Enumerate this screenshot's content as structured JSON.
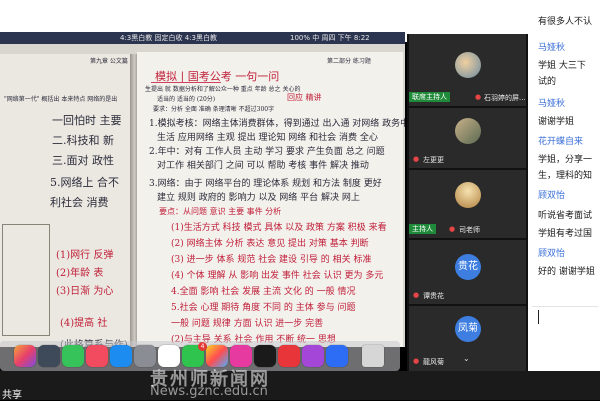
{
  "menubar": {
    "left": "4:3黑白教 固定白收 4:3黑白教",
    "right": "100% 中 周四 下午 8:22"
  },
  "document": {
    "left_page": {
      "header": "第九章 公文篇",
      "quote": "\"网络第一代\" 概括出 本来特点 网络的是出"
    },
    "right_page": {
      "header": "第二部分 练习题",
      "title_red": "模拟 | 国考公考 一句一问",
      "subtitle": "回应 精讲"
    }
  },
  "dock": {
    "apps": [
      "finder",
      "launchpad",
      "messages",
      "music",
      "app-store",
      "settings",
      "calendar",
      "wechat",
      "photos",
      "video",
      "netease-music",
      "podcasts",
      "lark",
      "trash"
    ],
    "badge_wechat": "4"
  },
  "participants": [
    {
      "name": "石羽婷的屏...",
      "badge": "联席主持人",
      "type": "photo"
    },
    {
      "name": "左更更",
      "badge": "",
      "type": "photo"
    },
    {
      "name": "司老师",
      "badge": "主持人",
      "type": "photo"
    },
    {
      "name": "谭贵花",
      "badge": "",
      "type": "text",
      "avatar": "贵花"
    },
    {
      "name": "龍风菊",
      "badge": "",
      "type": "text",
      "avatar": "凤菊"
    }
  ],
  "chat": {
    "messages": [
      {
        "sender": "",
        "text": "有很多人不认"
      },
      {
        "sender": "马娅秋",
        "text": "学姐 大三下"
      },
      {
        "sender": "",
        "text": "试的"
      },
      {
        "sender": "马娅秋",
        "text": "谢谢学姐"
      },
      {
        "sender": "花开蝶自来",
        "text": "学姐，分享一"
      },
      {
        "sender": "",
        "text": "生，理科的知"
      },
      {
        "sender": "顾双怡",
        "text": "听说省考面试"
      },
      {
        "sender": "",
        "text": "学姐有考过国"
      },
      {
        "sender": "顾双怡",
        "text": "好的 谢谢学姐"
      }
    ]
  },
  "bottom": {
    "share_label": "共享",
    "watermark": "贵州师新闻网",
    "watermark_url": "News.gznc.edu.cn"
  },
  "colors": {
    "chat_sender": "#3a6fd8",
    "host_badge": "#1f8a3a",
    "avatar_blue": "#3d7ee0"
  }
}
